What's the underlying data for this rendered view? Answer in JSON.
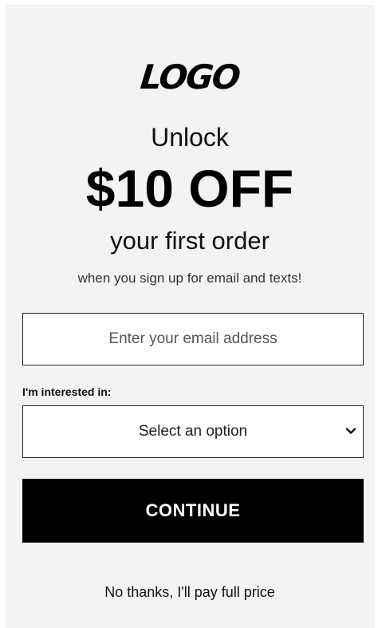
{
  "popup": {
    "logo_text": "LOGO",
    "headline_top": "Unlock",
    "headline_amount": "$10 OFF",
    "headline_bottom": "your first order",
    "subtext": "when you sign up for email and texts!"
  },
  "form": {
    "email": {
      "placeholder": "Enter your email address",
      "value": ""
    },
    "interest": {
      "label": "I'm interested in:",
      "selected_text": "Select an option",
      "icon": "chevron-down-icon"
    },
    "continue_label": "CONTINUE",
    "decline_label": "No thanks, I'll pay full price"
  },
  "colors": {
    "panel_background": "#f3f3f3",
    "button_background": "#000000",
    "button_text": "#ffffff"
  }
}
